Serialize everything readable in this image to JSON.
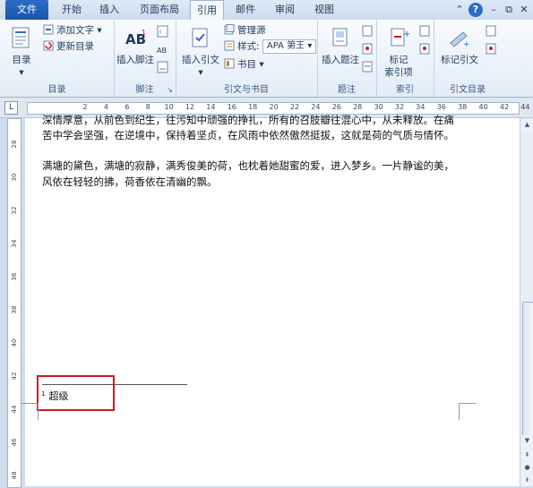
{
  "tabs": [
    "文件",
    "开始",
    "插入",
    "页面布局",
    "引用",
    "邮件",
    "审阅",
    "视图"
  ],
  "active_tab": "引用",
  "window_controls": {
    "collapse": "⌃",
    "help": "?",
    "minimize": "–",
    "restore": "⧉",
    "close": "✕"
  },
  "ribbon": {
    "toc": {
      "label": "目录",
      "arrow": "▾",
      "add_text": "添加文字",
      "add_text_arrow": "▾",
      "update": "更新目录",
      "group": "目录"
    },
    "footnote": {
      "insert": "插入脚注",
      "group": "脚注",
      "launcher": "↘"
    },
    "citation": {
      "insert": "插入引文",
      "arrow": "▾",
      "manage": "管理源",
      "style_label": "样式:",
      "style_value": "APA 第王",
      "style_arrow": "▾",
      "bibliography": "书目",
      "bibliography_arrow": "▾",
      "group": "引文与书目"
    },
    "caption": {
      "insert": "插入题注",
      "group": "题注"
    },
    "index": {
      "mark": "标记",
      "mark2": "索引项",
      "group": "索引"
    },
    "toa": {
      "mark": "标记引文",
      "group": "引文目录"
    }
  },
  "ruler": {
    "tab_selector": "L",
    "h_ticks": [
      "2",
      "4",
      "6",
      "8",
      "10",
      "12",
      "14",
      "16",
      "18",
      "20",
      "22",
      "24",
      "26",
      "28",
      "30",
      "32",
      "34",
      "36",
      "38",
      "40",
      "42",
      "44"
    ],
    "v_ticks": [
      "28",
      "30",
      "32",
      "34",
      "36",
      "38",
      "40",
      "42",
      "44",
      "46",
      "48"
    ]
  },
  "document": {
    "lines": [
      "深情厚意，从前色到纪生，往污知中顽强的挣扎，所有的召肢瓣往混心中，从未释放。在痛",
      "苦中学会坚强，在逆境中，保持着坚贞，在风雨中依然傲然挺拔，这就是荷的气质与情怀。",
      "满塘的黛色，满塘的寂静，满秀俊美的荷，也枕着她甜蜜的爱，进入梦乡。一片静谧的美，",
      "风依在轻轻的拂，荷香依在清幽的飘。"
    ],
    "footnote": {
      "number": "1",
      "text": "超级"
    }
  },
  "scrollbar": {
    "up": "▲",
    "down": "▼",
    "prev_page": "⇞",
    "browse": "●",
    "next_page": "⇟"
  },
  "colors": {
    "highlight": "#d3171d",
    "file_tab": "#1b56a8"
  }
}
